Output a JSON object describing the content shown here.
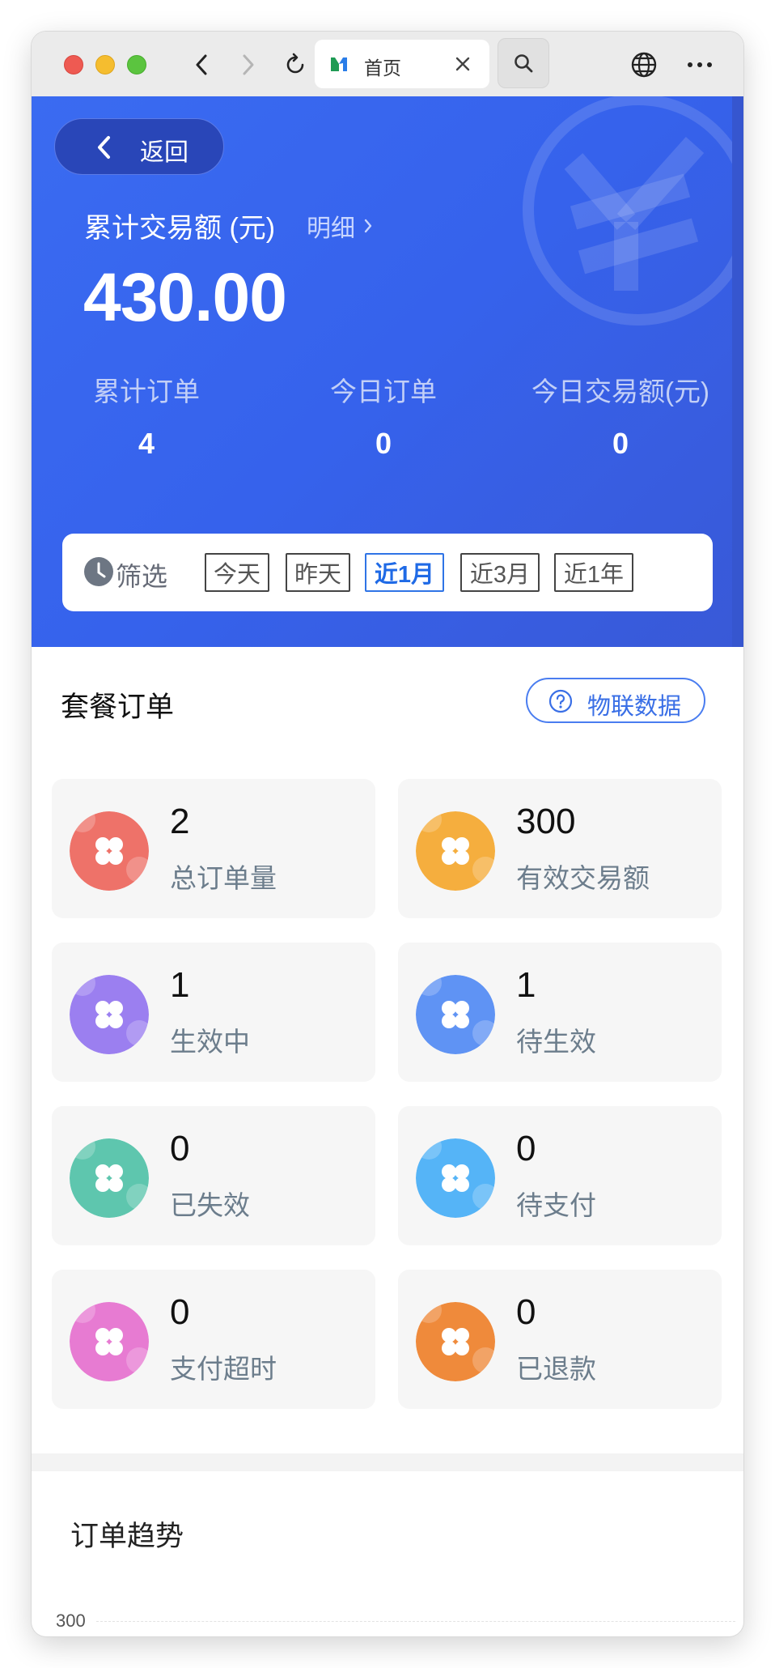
{
  "browser": {
    "tab_title": "首页"
  },
  "header": {
    "back_label": "返回",
    "total_label": "累计交易额 (元)",
    "detail_link": "明细",
    "total_value": "430.00",
    "stats": [
      {
        "label": "累计订单",
        "value": "4"
      },
      {
        "label": "今日订单",
        "value": "0"
      },
      {
        "label": "今日交易额(元)",
        "value": "0"
      }
    ],
    "filter": {
      "label": "筛选",
      "options": [
        "今天",
        "昨天",
        "近1月",
        "近3月",
        "近1年"
      ],
      "selected": "近1月"
    }
  },
  "package_orders": {
    "title": "套餐订单",
    "iot_button": "物联数据",
    "cards": [
      {
        "value": "2",
        "label": "总订单量",
        "color": "#ee7269"
      },
      {
        "value": "300",
        "label": "有效交易额",
        "color": "#f5ae3e"
      },
      {
        "value": "1",
        "label": "生效中",
        "color": "#9b7ff0"
      },
      {
        "value": "1",
        "label": "待生效",
        "color": "#5f93f4"
      },
      {
        "value": "0",
        "label": "已失效",
        "color": "#5ec6ae"
      },
      {
        "value": "0",
        "label": "待支付",
        "color": "#55b4f7"
      },
      {
        "value": "0",
        "label": "支付超时",
        "color": "#e77bd2"
      },
      {
        "value": "0",
        "label": "已退款",
        "color": "#ef8a3b"
      }
    ]
  },
  "trend": {
    "title": "订单趋势",
    "y_tick_top": "300"
  },
  "colors": {
    "header_blue": "#3a6bf1",
    "accent": "#2f74e6"
  }
}
